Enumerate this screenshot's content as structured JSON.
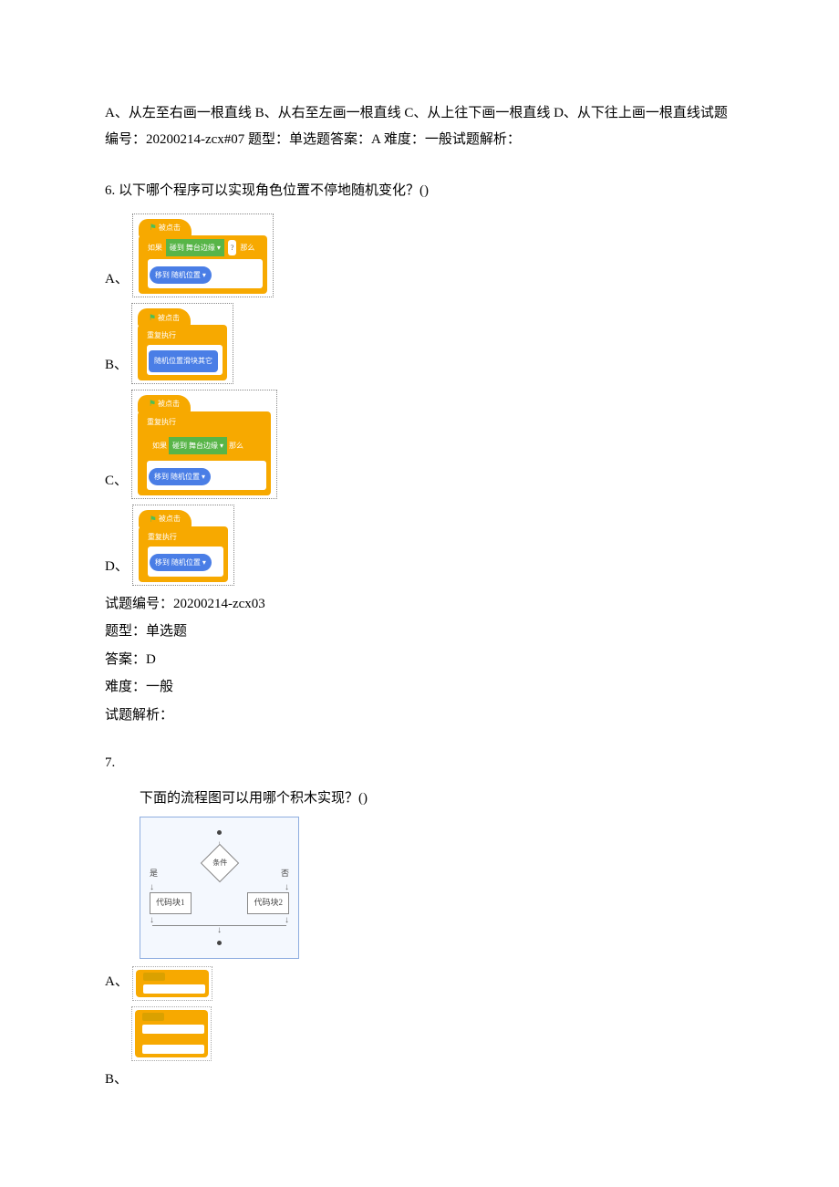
{
  "top_para": "A、从左至右画一根直线 B、从右至左画一根直线 C、从上往下画一根直线 D、从下往上画一根直线试题编号：20200214-zcx#07 题型：单选题答案：A 难度：一般试题解析：",
  "q6": {
    "title": "6. 以下哪个程序可以实现角色位置不停地随机变化？()",
    "opt_a": "A、",
    "opt_b": "B、",
    "opt_c": "C、",
    "opt_d": "D、",
    "meta_id": "试题编号：20200214-zcx03",
    "meta_type": "题型：单选题",
    "meta_ans": "答案：D",
    "meta_diff": "难度：一般",
    "meta_expl": "试题解析：",
    "blk": {
      "when_clicked": "被点击",
      "repeat_until": "重复执行",
      "forever": "重复执行",
      "if": "如果",
      "touching": "碰到 舞台边缘 ▾",
      "then": "那么",
      "goto_random": "移到 随机位置 ▾",
      "goto_random_btn": "随机位置滑块其它"
    }
  },
  "q7": {
    "num": "7.",
    "title": "下面的流程图可以用哪个积木实现？()",
    "flow": {
      "cond": "条件",
      "yes": "是",
      "no": "否",
      "b1": "代码块1",
      "b2": "代码块2"
    },
    "opt_a": "A、",
    "opt_b": "B、"
  }
}
